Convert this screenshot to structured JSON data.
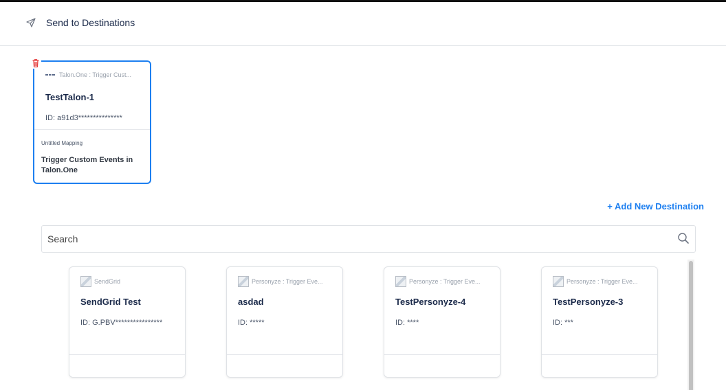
{
  "header": {
    "title": "Send to Destinations",
    "icon": "send-icon"
  },
  "selected_destination": {
    "source": "Talon.One : Trigger Cust...",
    "name": "TestTalon-1",
    "id": "ID: a91d3***************",
    "mapping_label": "Untitled Mapping",
    "mapping_name": "Trigger Custom Events in Talon.One"
  },
  "add_destination_label": "+ Add New Destination",
  "search": {
    "placeholder": "Search",
    "value": ""
  },
  "destinations": [
    {
      "source": "SendGrid",
      "name": "SendGrid Test",
      "id": "ID: G.PBV****************"
    },
    {
      "source": "Personyze : Trigger Eve...",
      "name": "asdad",
      "id": "ID: *****"
    },
    {
      "source": "Personyze : Trigger Eve...",
      "name": "TestPersonyze-4",
      "id": "ID: ****"
    },
    {
      "source": "Personyze : Trigger Eve...",
      "name": "TestPersonyze-3",
      "id": "ID: ***"
    }
  ],
  "colors": {
    "accent": "#1d7ff0",
    "delete": "#e53e3e",
    "text": "#1b2a4a"
  }
}
